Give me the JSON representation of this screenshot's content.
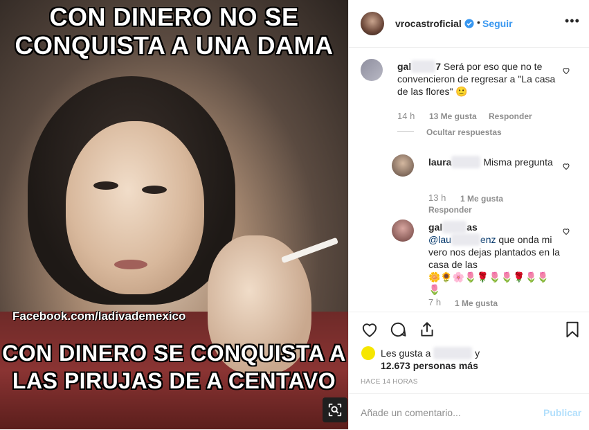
{
  "post": {
    "image_top_text": "CON DINERO NO SE CONQUISTA A UNA DAMA",
    "image_bottom_text": "CON DINERO SE CONQUISTA A LAS PIRUJAS DE A CENTAVO",
    "watermark": "Facebook.com/ladivademexico"
  },
  "header": {
    "username": "vrocastroficial",
    "separator": "•",
    "follow_label": "Seguir",
    "more_label": "•••"
  },
  "comments": [
    {
      "user_visible": "gal",
      "text": "Será por eso que no te convencieron de regresar a \"La casa de las flores\" 🙂",
      "time": "14 h",
      "likes": "13 Me gusta",
      "reply_label": "Responder",
      "hide_label": "Ocultar respuestas"
    },
    {
      "user_visible": "laura",
      "text": "Misma pregunta",
      "time": "13 h",
      "likes": "1 Me gusta",
      "reply_label": "Responder"
    },
    {
      "user_visible": "gal",
      "user_suffix": "as",
      "mention_visible": "@lau",
      "mention_suffix": "enz",
      "text": "que onda mi vero nos dejas plantados en la casa de las",
      "emojis": "🌼🌻🌸🌷🌹🌷🌷🌹🌷🌷🌷",
      "time": "7 h",
      "likes": "1 Me gusta"
    }
  ],
  "likes": {
    "prefix": "Les gusta a",
    "suffix": "y",
    "count_text": "12.673 personas más"
  },
  "time_ago": "HACE 14 HORAS",
  "add_comment": {
    "placeholder": "Añade un comentario...",
    "publish_label": "Publicar"
  },
  "colors": {
    "accent_blue": "#3897f0",
    "publish_disabled": "#b2dffc",
    "muted_text": "#8e8e8e"
  }
}
